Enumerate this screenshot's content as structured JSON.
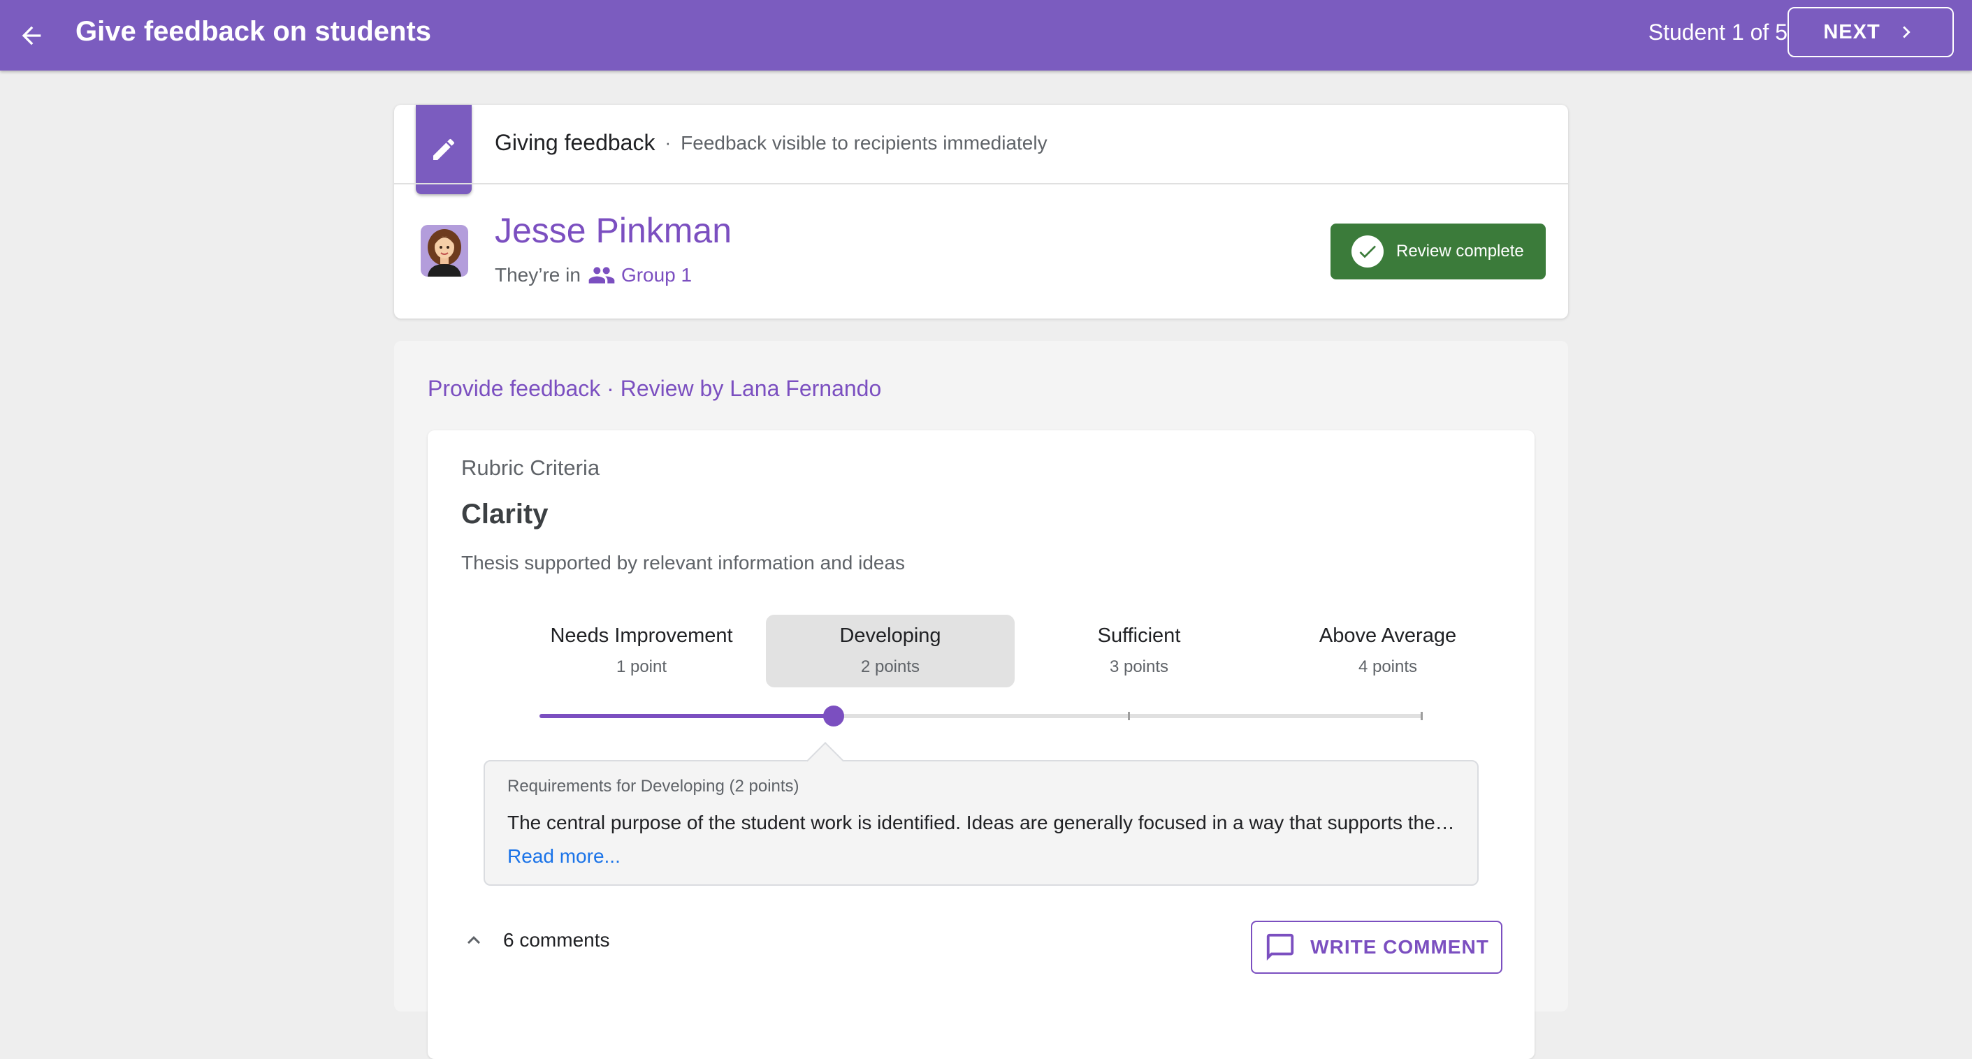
{
  "app_bar": {
    "title": "Give feedback on students",
    "student_counter": "Student 1 of 5",
    "next_label": "NEXT",
    "color": "#7b5cbf"
  },
  "header": {
    "mode_label": "Giving feedback",
    "separator": "·",
    "mode_description": "Feedback visible to recipients immediately",
    "student_name": "Jesse Pinkman",
    "group_prefix": "They’re in",
    "group_name": "Group 1",
    "review_status": "Review complete",
    "review_status_color": "#3b7b3a"
  },
  "feedback": {
    "section_title": "Provide feedback · Review by Lana Fernando",
    "rubric_label": "Rubric Criteria",
    "criterion_title": "Clarity",
    "criterion_description": "Thesis supported by relevant information and ideas",
    "levels": [
      {
        "name": "Needs Improvement",
        "points": "1 point"
      },
      {
        "name": "Developing",
        "points": "2 points"
      },
      {
        "name": "Sufficient",
        "points": "3 points"
      },
      {
        "name": "Above Average",
        "points": "4 points"
      }
    ],
    "selected_level_index": 1,
    "requirements_title": "Requirements for Developing (2 points)",
    "requirements_text": "The central purpose of the student work is identified. Ideas are generally focused in a way that supports the…",
    "read_more_label": "Read more...",
    "comments_label": "6 comments",
    "write_comment_label": "WRITE COMMENT"
  },
  "icons": {
    "back": "arrow-back-icon",
    "next": "chevron-right-icon",
    "mode": "pencil-icon",
    "group": "people-icon",
    "review": "check-icon",
    "comments_toggle": "chevron-up-icon",
    "write_comment": "comment-icon"
  }
}
